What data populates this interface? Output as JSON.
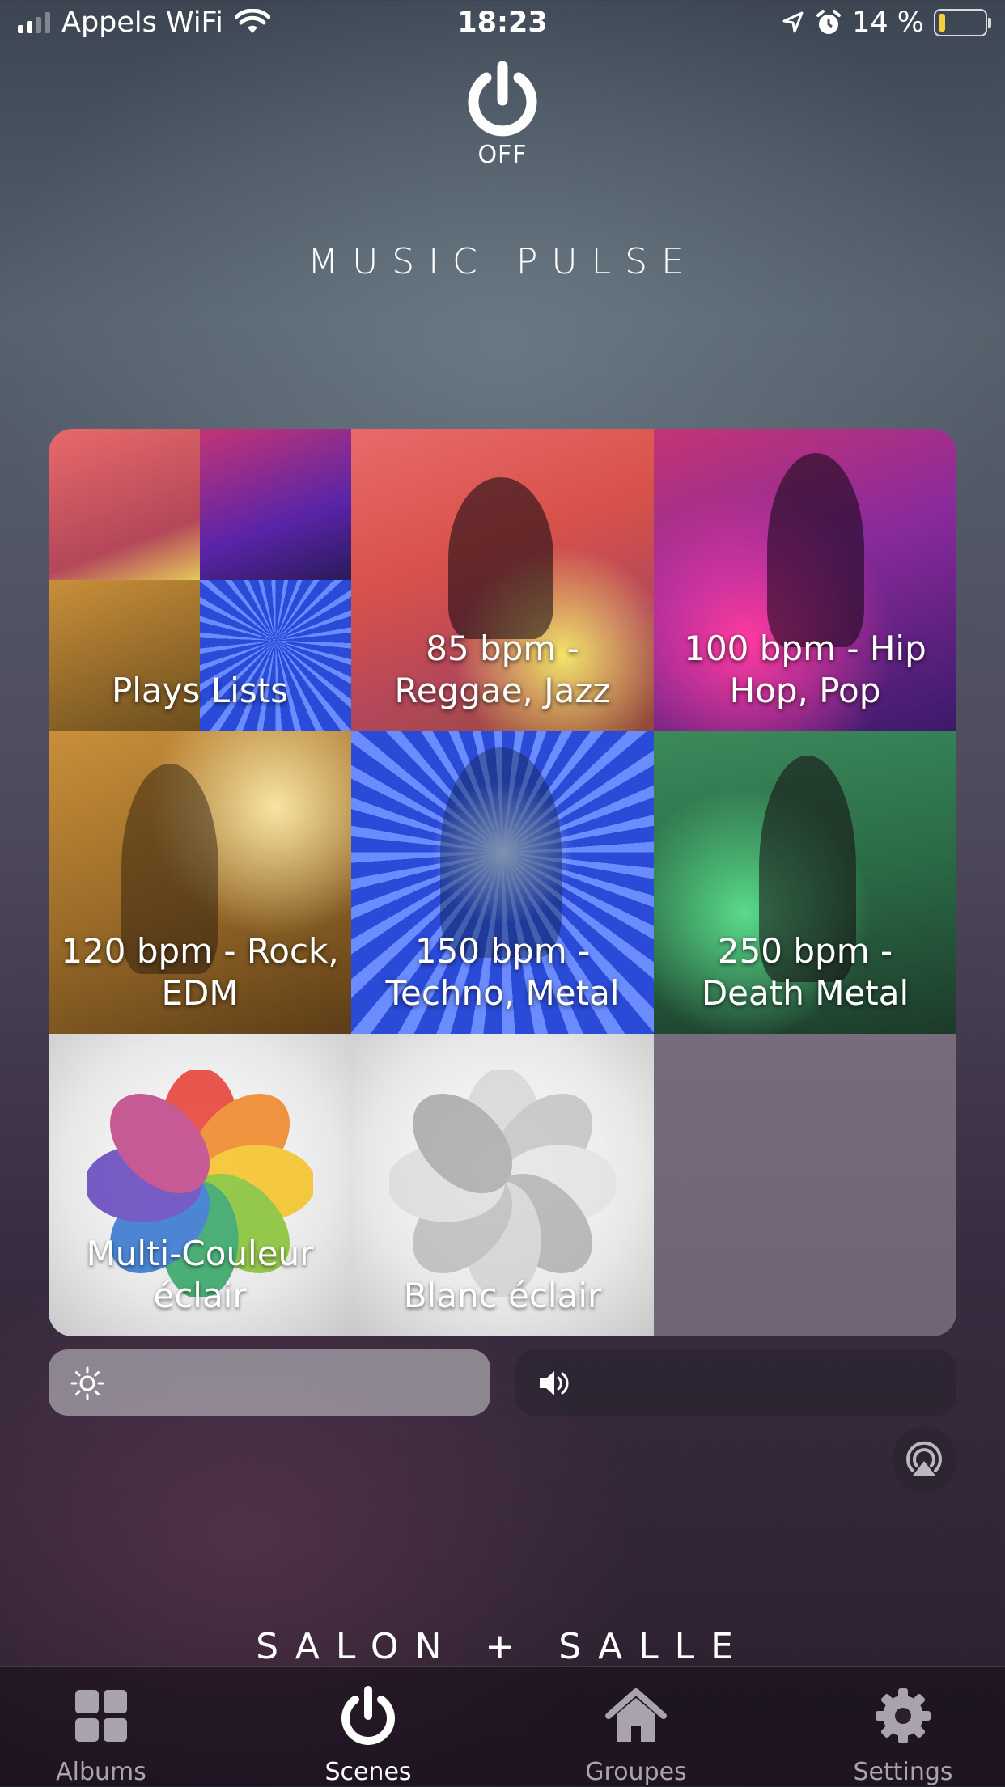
{
  "status_bar": {
    "carrier": "Appels WiFi",
    "time": "18:23",
    "battery": "14 %",
    "battery_level": 0.14
  },
  "power": {
    "label": "OFF"
  },
  "scene_title": "MUSIC PULSE",
  "tiles": [
    {
      "label": "Plays Lists"
    },
    {
      "label": "85 bpm - Reggae, Jazz"
    },
    {
      "label": "100 bpm - Hip Hop, Pop"
    },
    {
      "label": "120 bpm - Rock, EDM"
    },
    {
      "label": "150 bpm - Techno, Metal"
    },
    {
      "label": "250 bpm - Death Metal"
    },
    {
      "label": "Multi-Couleur éclair"
    },
    {
      "label": "Blanc éclair"
    }
  ],
  "sliders": {
    "brightness_icon": "sun-icon",
    "volume_icon": "speaker-icon",
    "airplay_icon": "airplay-icon"
  },
  "room_name": "SALON + SALLE",
  "tabs": [
    {
      "label": "Albums",
      "icon": "grid-icon"
    },
    {
      "label": "Scenes",
      "icon": "power-icon"
    },
    {
      "label": "Groupes",
      "icon": "home-icon"
    },
    {
      "label": "Settings",
      "icon": "gear-icon"
    }
  ],
  "colors": {
    "battery_fill": "#f4d03a",
    "tab_active": "#ffffff",
    "tab_inactive": "#a9a3ad"
  }
}
